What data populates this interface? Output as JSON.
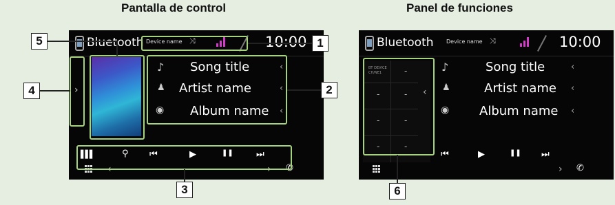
{
  "left": {
    "title": "Pantalla de control",
    "header": {
      "source": "Bluetooth",
      "device": "Device name",
      "time": "10:00"
    },
    "track": {
      "song": "Song title",
      "artist": "Artist name",
      "album": "Album name"
    },
    "controls": {
      "prev": "⏮",
      "play": "▶",
      "pause": "❚❚",
      "next": "⏭"
    }
  },
  "right": {
    "title": "Panel de funciones",
    "header": {
      "source": "Bluetooth",
      "device": "Device name",
      "time": "10:00"
    },
    "track": {
      "song": "Song title",
      "artist": "Artist name",
      "album": "Album name"
    },
    "controls": {
      "prev": "⏮",
      "play": "▶",
      "pause": "❚❚",
      "next": "⏭"
    },
    "function_panel": {
      "top_label": "BT DEVICE CH/NE1",
      "cells": [
        "-",
        "-",
        "-",
        "-",
        "-",
        "-",
        "-"
      ]
    }
  },
  "callouts": [
    "1",
    "2",
    "3",
    "4",
    "5",
    "6"
  ],
  "colors": {
    "highlight": "#a7d37e",
    "signal": "#d33cc8",
    "background": "#e6ede1"
  },
  "icons": [
    "bluetooth-device-icon",
    "shuffle-icon",
    "search-icon",
    "equalizer-icon",
    "note-icon",
    "person-icon",
    "disc-icon",
    "grid-icon",
    "phone-icon",
    "chevron-icon"
  ]
}
